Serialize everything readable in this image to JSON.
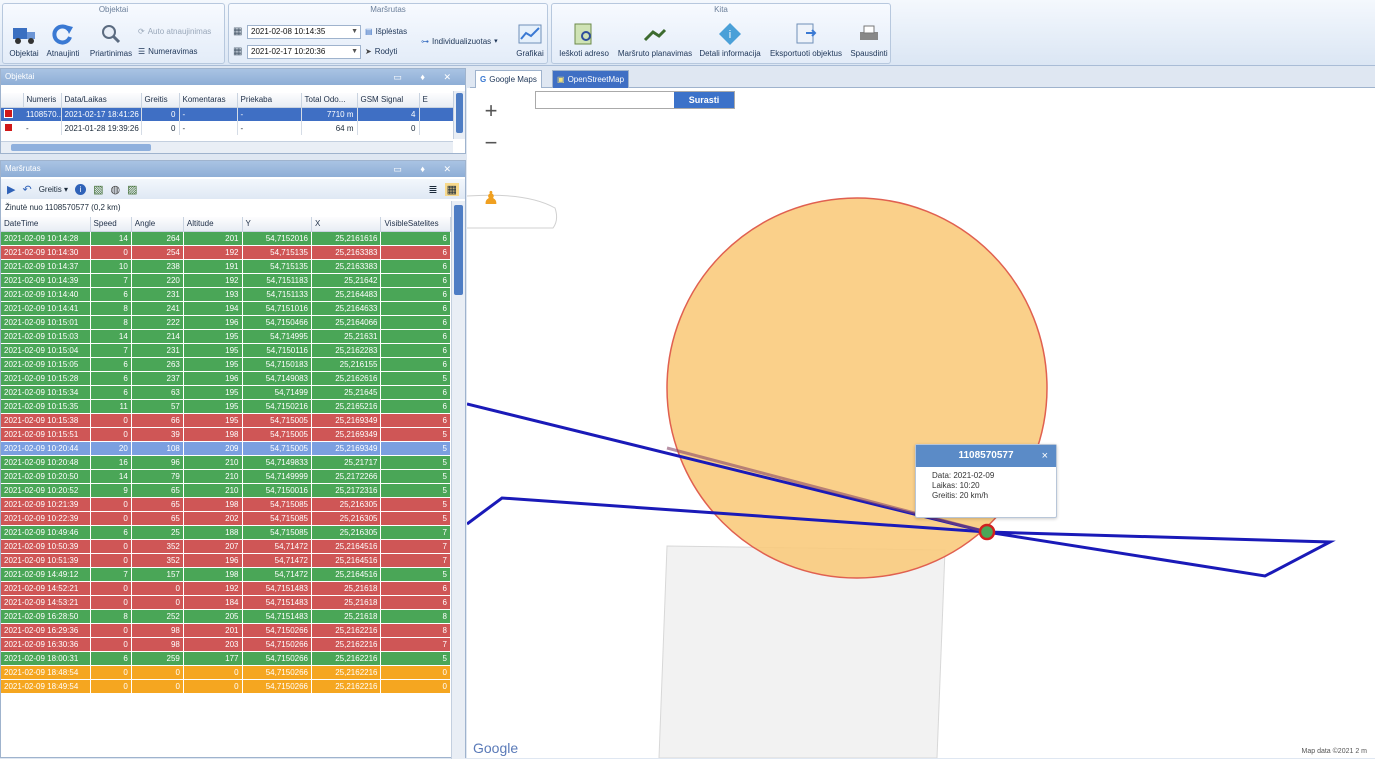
{
  "ribbon": {
    "groups": {
      "objektai": "Objektai",
      "marsrutas": "Maršrutas",
      "kita": "Kita"
    },
    "buttons": {
      "objektai": "Objektai",
      "atnaujinti": "Atnaujinti",
      "priartinimas": "Priartinimas",
      "auto_atnaujinimas": "Auto atnaujinimas",
      "numeravimas": "Numeravimas",
      "isplestas": "Išplėstas",
      "rodyti": "Rodyti",
      "individualizuotas": "Individualizuotas",
      "grafikai": "Grafikai",
      "ieskoti_adreso": "Ieškoti adreso",
      "marsruto_planavimas": "Maršruto planavimas",
      "detali_informacija": "Detali informacija",
      "eksportuoti": "Eksportuoti objektus",
      "spausdinti": "Spausdinti"
    },
    "date_from": "2021-02-08 10:14:35",
    "date_to": "2021-02-17 10:20:36"
  },
  "objects_panel": {
    "title": "Objektai",
    "columns": [
      "Numeris",
      "Data/Laikas",
      "Greitis",
      "Komentaras",
      "Priekaba",
      "Total Odo...",
      "GSM Signal",
      "E"
    ],
    "rows": [
      {
        "numeris": "1108570...",
        "data": "2021-02-17 18:41:26",
        "greitis": "0",
        "komentaras": "-",
        "priekaba": "-",
        "odo": "7710 m",
        "gsm": "4"
      },
      {
        "numeris": "-",
        "data": "2021-01-28 19:39:26",
        "greitis": "0",
        "komentaras": "-",
        "priekaba": "-",
        "odo": "64 m",
        "gsm": "0"
      }
    ]
  },
  "route_panel": {
    "title": "Maršrutas",
    "toolbar_speed": "Greitis",
    "trail_label": "Žinutė nuo 1108570577 (0,2 km)",
    "columns": [
      "DateTime",
      "Speed",
      "Angle",
      "Altitude",
      "Y",
      "X",
      "VisibleSatelites"
    ],
    "rows": [
      {
        "c": "green",
        "t": "2021-02-09 10:14:28",
        "s": "14",
        "a": "264",
        "al": "201",
        "y": "54,7152016",
        "x": "25,2161616",
        "v": "6"
      },
      {
        "c": "red",
        "t": "2021-02-09 10:14:30",
        "s": "0",
        "a": "254",
        "al": "192",
        "y": "54,715135",
        "x": "25,2163383",
        "v": "6"
      },
      {
        "c": "green",
        "t": "2021-02-09 10:14:37",
        "s": "10",
        "a": "238",
        "al": "191",
        "y": "54,715135",
        "x": "25,2163383",
        "v": "6"
      },
      {
        "c": "green",
        "t": "2021-02-09 10:14:39",
        "s": "7",
        "a": "220",
        "al": "192",
        "y": "54,7151183",
        "x": "25,21642",
        "v": "6"
      },
      {
        "c": "green",
        "t": "2021-02-09 10:14:40",
        "s": "6",
        "a": "231",
        "al": "193",
        "y": "54,7151133",
        "x": "25,2164483",
        "v": "6"
      },
      {
        "c": "green",
        "t": "2021-02-09 10:14:41",
        "s": "8",
        "a": "241",
        "al": "194",
        "y": "54,7151016",
        "x": "25,2164633",
        "v": "6"
      },
      {
        "c": "green",
        "t": "2021-02-09 10:15:01",
        "s": "8",
        "a": "222",
        "al": "196",
        "y": "54,7150466",
        "x": "25,2164066",
        "v": "6"
      },
      {
        "c": "green",
        "t": "2021-02-09 10:15:03",
        "s": "14",
        "a": "214",
        "al": "195",
        "y": "54,714995",
        "x": "25,21631",
        "v": "6"
      },
      {
        "c": "green",
        "t": "2021-02-09 10:15:04",
        "s": "7",
        "a": "231",
        "al": "195",
        "y": "54,7150116",
        "x": "25,2162283",
        "v": "6"
      },
      {
        "c": "green",
        "t": "2021-02-09 10:15:05",
        "s": "6",
        "a": "263",
        "al": "195",
        "y": "54,7150183",
        "x": "25,216155",
        "v": "6"
      },
      {
        "c": "green",
        "t": "2021-02-09 10:15:28",
        "s": "6",
        "a": "237",
        "al": "196",
        "y": "54,7149083",
        "x": "25,2162616",
        "v": "5"
      },
      {
        "c": "green",
        "t": "2021-02-09 10:15:34",
        "s": "6",
        "a": "63",
        "al": "195",
        "y": "54,71499",
        "x": "25,21645",
        "v": "6"
      },
      {
        "c": "green",
        "t": "2021-02-09 10:15:35",
        "s": "11",
        "a": "57",
        "al": "195",
        "y": "54,7150216",
        "x": "25,2165216",
        "v": "6"
      },
      {
        "c": "red",
        "t": "2021-02-09 10:15:38",
        "s": "0",
        "a": "66",
        "al": "195",
        "y": "54,715005",
        "x": "25,2169349",
        "v": "6"
      },
      {
        "c": "red",
        "t": "2021-02-09 10:15:51",
        "s": "0",
        "a": "39",
        "al": "198",
        "y": "54,715005",
        "x": "25,2169349",
        "v": "5"
      },
      {
        "c": "blue",
        "t": "2021-02-09 10:20:44",
        "s": "20",
        "a": "108",
        "al": "209",
        "y": "54,715005",
        "x": "25,2169349",
        "v": "5"
      },
      {
        "c": "green",
        "t": "2021-02-09 10:20:48",
        "s": "16",
        "a": "96",
        "al": "210",
        "y": "54,7149833",
        "x": "25,21717",
        "v": "5"
      },
      {
        "c": "green",
        "t": "2021-02-09 10:20:50",
        "s": "14",
        "a": "79",
        "al": "210",
        "y": "54,7149999",
        "x": "25,2172266",
        "v": "5"
      },
      {
        "c": "green",
        "t": "2021-02-09 10:20:52",
        "s": "9",
        "a": "65",
        "al": "210",
        "y": "54,7150016",
        "x": "25,2172316",
        "v": "5"
      },
      {
        "c": "red",
        "t": "2021-02-09 10:21:39",
        "s": "0",
        "a": "65",
        "al": "198",
        "y": "54,715085",
        "x": "25,216305",
        "v": "5"
      },
      {
        "c": "red",
        "t": "2021-02-09 10:22:39",
        "s": "0",
        "a": "65",
        "al": "202",
        "y": "54,715085",
        "x": "25,216305",
        "v": "5"
      },
      {
        "c": "green",
        "t": "2021-02-09 10:49:46",
        "s": "6",
        "a": "25",
        "al": "188",
        "y": "54,715085",
        "x": "25,216305",
        "v": "7"
      },
      {
        "c": "red",
        "t": "2021-02-09 10:50:39",
        "s": "0",
        "a": "352",
        "al": "207",
        "y": "54,71472",
        "x": "25,2164516",
        "v": "7"
      },
      {
        "c": "red",
        "t": "2021-02-09 10:51:39",
        "s": "0",
        "a": "352",
        "al": "196",
        "y": "54,71472",
        "x": "25,2164516",
        "v": "7"
      },
      {
        "c": "green",
        "t": "2021-02-09 14:49:12",
        "s": "7",
        "a": "157",
        "al": "198",
        "y": "54,71472",
        "x": "25,2164516",
        "v": "5"
      },
      {
        "c": "red",
        "t": "2021-02-09 14:52:21",
        "s": "0",
        "a": "0",
        "al": "192",
        "y": "54,7151483",
        "x": "25,21618",
        "v": "6"
      },
      {
        "c": "red",
        "t": "2021-02-09 14:53:21",
        "s": "0",
        "a": "0",
        "al": "184",
        "y": "54,7151483",
        "x": "25,21618",
        "v": "6"
      },
      {
        "c": "green",
        "t": "2021-02-09 16:28:50",
        "s": "8",
        "a": "252",
        "al": "205",
        "y": "54,7151483",
        "x": "25,21618",
        "v": "8"
      },
      {
        "c": "red",
        "t": "2021-02-09 16:29:36",
        "s": "0",
        "a": "98",
        "al": "201",
        "y": "54,7150266",
        "x": "25,2162216",
        "v": "8"
      },
      {
        "c": "red",
        "t": "2021-02-09 16:30:36",
        "s": "0",
        "a": "98",
        "al": "203",
        "y": "54,7150266",
        "x": "25,2162216",
        "v": "7"
      },
      {
        "c": "green",
        "t": "2021-02-09 18:00:31",
        "s": "6",
        "a": "259",
        "al": "177",
        "y": "54,7150266",
        "x": "25,2162216",
        "v": "5"
      },
      {
        "c": "orange",
        "t": "2021-02-09 18:48:54",
        "s": "0",
        "a": "0",
        "al": "0",
        "y": "54,7150266",
        "x": "25,2162216",
        "v": "0"
      },
      {
        "c": "orange",
        "t": "2021-02-09 18:49:54",
        "s": "0",
        "a": "0",
        "al": "0",
        "y": "54,7150266",
        "x": "25,2162216",
        "v": "0"
      }
    ]
  },
  "map": {
    "tabs": [
      "Google Maps",
      "OpenStreetMap"
    ],
    "search_button": "Surasti",
    "search_value": "",
    "zoom_in": "+",
    "zoom_out": "−",
    "popup": {
      "title": "1108570577",
      "close": "×",
      "date": "Data: 2021-02-09",
      "time": "Laikas: 10:20",
      "speed": "Greitis: 20 km/h"
    },
    "logo": "Google",
    "attribution": "Map data ©2021   2 m"
  },
  "colors": {
    "row_green": "#4aa657",
    "row_red": "#cf5656",
    "row_orange": "#f5a620",
    "row_blue": "#7b9fe0",
    "route_line": "#1a1ab8",
    "accuracy_circle": "#f9c97a"
  }
}
